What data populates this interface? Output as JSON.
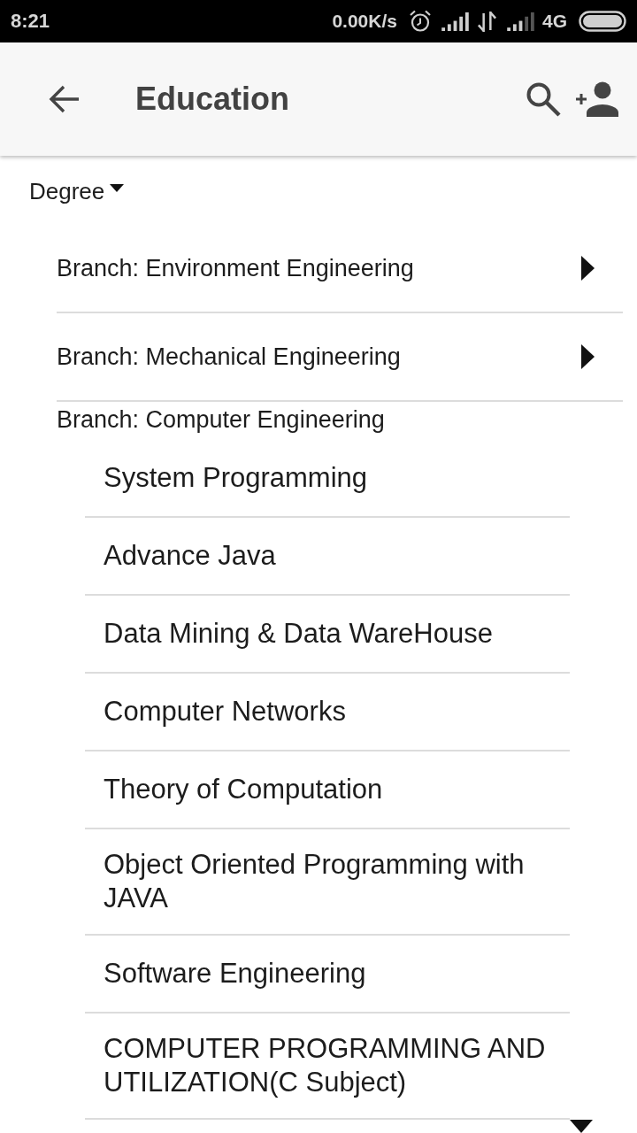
{
  "status_bar": {
    "time": "8:21",
    "net_speed": "0.00K/s",
    "network_type": "4G"
  },
  "app_bar": {
    "title": "Education"
  },
  "tree": {
    "label": "Degree",
    "expanded": true,
    "children": [
      {
        "label": "Branch: Environment Engineering",
        "expanded": false
      },
      {
        "label": "Branch: Mechanical Engineering",
        "expanded": false
      },
      {
        "label": "Branch: Computer Engineering",
        "expanded": true,
        "children": [
          {
            "label": "System Programming"
          },
          {
            "label": "Advance Java"
          },
          {
            "label": "Data Mining & Data WareHouse"
          },
          {
            "label": "Computer Networks"
          },
          {
            "label": "Theory of Computation"
          },
          {
            "label": "Object Oriented Programming with JAVA"
          },
          {
            "label": "Software Engineering"
          },
          {
            "label": "COMPUTER PROGRAMMING AND UTILIZATION(C Subject)"
          }
        ]
      }
    ]
  }
}
